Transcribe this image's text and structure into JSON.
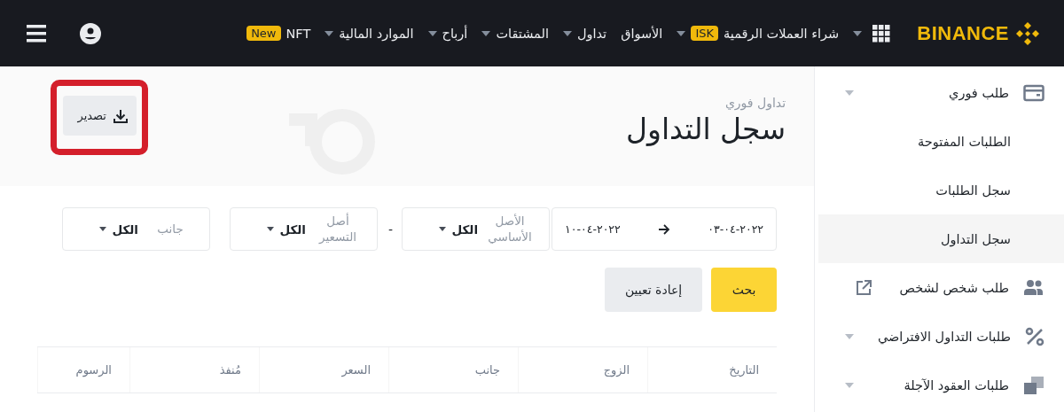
{
  "header": {
    "logo": "BINANCE",
    "nav": [
      {
        "label": "شراء العملات الرقمية",
        "badge": "ISK",
        "dropdown": true
      },
      {
        "label": "الأسواق",
        "dropdown": false
      },
      {
        "label": "تداول",
        "dropdown": true
      },
      {
        "label": "المشتقات",
        "dropdown": true
      },
      {
        "label": "أرباح",
        "dropdown": true
      },
      {
        "label": "الموارد المالية",
        "dropdown": true
      },
      {
        "label": "NFT",
        "badge": "New",
        "dropdown": false
      }
    ]
  },
  "page": {
    "breadcrumb": "تداول فوري",
    "title": "سجل التداول",
    "export": "تصدير"
  },
  "filters": [
    {
      "kind": "date",
      "from": "٠٣-٠٤-٢٠٢٢",
      "to": "١٠-٠٤-٢٠٢٢"
    },
    {
      "kind": "select",
      "label": "الأصل الأساسي",
      "value": "الكل"
    },
    {
      "kind": "dash",
      "text": "-"
    },
    {
      "kind": "select",
      "label": "أصل التسعير",
      "value": "الكل"
    },
    {
      "kind": "select",
      "label": "جانب",
      "value": "الكل"
    }
  ],
  "buttons": {
    "search": "بحث",
    "reset": "إعادة تعيين"
  },
  "table": {
    "columns": [
      "التاريخ",
      "الزوج",
      "جانب",
      "السعر",
      "مُنفذ",
      "الرسوم"
    ]
  },
  "sidebar": {
    "items": [
      {
        "label": "طلب فوري",
        "kind": "group",
        "dropdown": true,
        "external": false
      },
      {
        "label": "الطلبات المفتوحة",
        "kind": "sub",
        "selected": false
      },
      {
        "label": "سجل الطلبات",
        "kind": "sub",
        "selected": false
      },
      {
        "label": "سجل التداول",
        "kind": "sub",
        "selected": true
      },
      {
        "label": "طلب شخص لشخص",
        "kind": "group",
        "dropdown": false,
        "external": true
      },
      {
        "label": "طلبات التداول الافتراضي",
        "kind": "group",
        "dropdown": true,
        "external": false
      },
      {
        "label": "طلبات العقود الآجلة",
        "kind": "group",
        "dropdown": true,
        "external": false
      }
    ]
  }
}
